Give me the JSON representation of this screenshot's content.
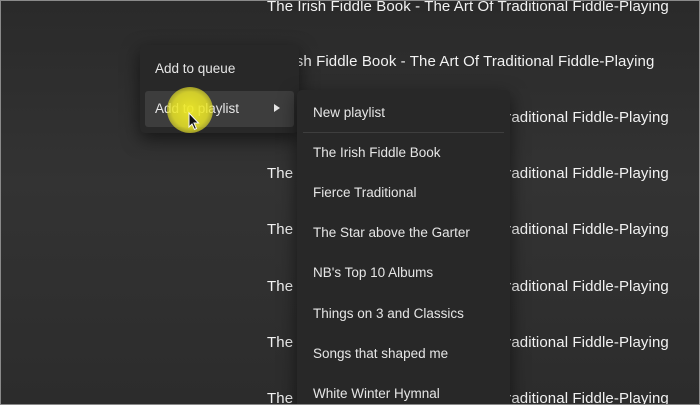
{
  "background_rows": [
    {
      "text": "The Irish Fiddle Book - The Art Of Traditional Fiddle-Playing"
    },
    {
      "text": "Irish Fiddle Book - The Art Of Traditional Fiddle-Playing"
    },
    {
      "text": "The Irish Fiddle Book - The Art Of Traditional Fiddle-Playing"
    },
    {
      "text": "The Irish Fiddle Book - The Art Of Traditional Fiddle-Playing"
    },
    {
      "text": "The Irish Fiddle Book - The Art Of Traditional Fiddle-Playing"
    },
    {
      "text": "The Irish Fiddle Book - The Art Of Traditional Fiddle-Playing"
    },
    {
      "text": "The Irish Fiddle Book - The Art Of Traditional Fiddle-Playing"
    },
    {
      "text": "The Irish Fiddle Book - The Art Of Traditional Fiddle-Playing"
    }
  ],
  "context_menu": {
    "items": [
      {
        "label": "Add to queue"
      },
      {
        "label": "Add to playlist",
        "has_submenu": true,
        "active": true
      }
    ]
  },
  "playlist_submenu": {
    "new_playlist_label": "New playlist",
    "playlists": [
      "The Irish Fiddle Book",
      "Fierce Traditional",
      "The Star above the Garter",
      "NB's Top 10 Albums",
      "Things on 3 and Classics",
      "Songs that shaped me",
      "White Winter Hymnal"
    ]
  },
  "colors": {
    "menu_bg": "#282828",
    "menu_active": "#3d3d3d",
    "text": "#e6e6e6",
    "cursor_highlight": "#f0eb28"
  }
}
